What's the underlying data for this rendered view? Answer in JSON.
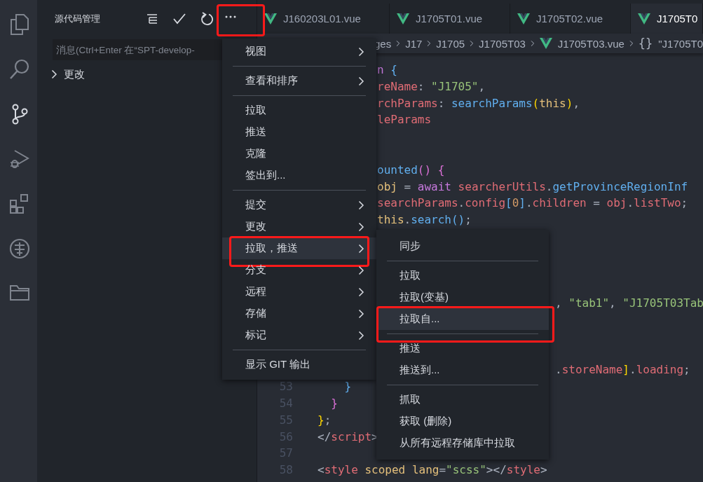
{
  "activity_bar": {
    "items": [
      {
        "kind": "files",
        "selected": false
      },
      {
        "kind": "search",
        "selected": false
      },
      {
        "kind": "source-control",
        "selected": true
      },
      {
        "kind": "run",
        "selected": false
      },
      {
        "kind": "extensions",
        "selected": false
      },
      {
        "kind": "coin",
        "selected": false
      },
      {
        "kind": "folder",
        "selected": false
      }
    ]
  },
  "sidebar": {
    "title": "源代码管理",
    "actions": [
      {
        "kind": "tree",
        "annotated": false
      },
      {
        "kind": "check",
        "annotated": false
      },
      {
        "kind": "refresh",
        "annotated": false
      },
      {
        "kind": "more",
        "annotated": true
      }
    ],
    "message": {
      "placeholder": "消息(Ctrl+Enter 在“SPT-develop-"
    },
    "sections": [
      {
        "label": "更改",
        "expanded": false
      }
    ]
  },
  "tabs": [
    {
      "label": "J160203L01.vue",
      "selected": false
    },
    {
      "label": "J1705T01.vue",
      "selected": false
    },
    {
      "label": "J1705T02.vue",
      "selected": false
    },
    {
      "label": "J1705T0",
      "selected": true
    }
  ],
  "breadcrumb": [
    {
      "kind": "folder",
      "label": "ges"
    },
    {
      "kind": "folder",
      "label": "J17"
    },
    {
      "kind": "folder",
      "label": "J1705"
    },
    {
      "kind": "folder",
      "label": "J1705T03"
    },
    {
      "kind": "file",
      "label": "J1705T03.vue"
    },
    {
      "kind": "symbol",
      "icon": "{}",
      "label": "\"J1705T0"
    }
  ],
  "code": [
    {
      "kind": "code",
      "tokens": [
        {
          "kind": "keyword",
          "text": "n"
        },
        {
          "kind": "bracket-blue",
          "text": " {"
        }
      ]
    },
    {
      "kind": "code",
      "tokens": [
        {
          "kind": "property",
          "text": "reName"
        },
        {
          "kind": "punct",
          "text": ": "
        },
        {
          "kind": "string",
          "text": "\"J1705\""
        },
        {
          "kind": "punct",
          "text": ","
        }
      ]
    },
    {
      "kind": "code",
      "tokens": [
        {
          "kind": "property",
          "text": "rchParams"
        },
        {
          "kind": "punct",
          "text": ": "
        },
        {
          "kind": "function",
          "text": "searchParams"
        },
        {
          "kind": "bracket-gold",
          "text": "("
        },
        {
          "kind": "variable",
          "text": "this"
        },
        {
          "kind": "bracket-gold",
          "text": ")"
        },
        {
          "kind": "punct",
          "text": ","
        }
      ]
    },
    {
      "kind": "code",
      "tokens": [
        {
          "kind": "property",
          "text": "leParams"
        }
      ]
    },
    {
      "kind": "blank"
    },
    {
      "kind": "blank"
    },
    {
      "kind": "code",
      "tokens": [
        {
          "kind": "function",
          "text": "ounted"
        },
        {
          "kind": "bracket-pink",
          "text": "()"
        },
        {
          "kind": "bracket-pink",
          "text": " {"
        }
      ]
    },
    {
      "kind": "code",
      "tokens": [
        {
          "kind": "variable",
          "text": "obj"
        },
        {
          "kind": "punct",
          "text": " = "
        },
        {
          "kind": "keyword",
          "text": "await"
        },
        {
          "kind": "property",
          "text": " searcherUtils"
        },
        {
          "kind": "punct",
          "text": "."
        },
        {
          "kind": "function",
          "text": "getProvinceRegionInf"
        }
      ]
    },
    {
      "kind": "code",
      "tokens": [
        {
          "kind": "property",
          "text": "searchParams"
        },
        {
          "kind": "punct",
          "text": "."
        },
        {
          "kind": "property",
          "text": "config"
        },
        {
          "kind": "bracket-blue",
          "text": "["
        },
        {
          "kind": "number",
          "text": "0"
        },
        {
          "kind": "bracket-blue",
          "text": "]"
        },
        {
          "kind": "punct",
          "text": "."
        },
        {
          "kind": "property",
          "text": "children"
        },
        {
          "kind": "punct",
          "text": " = "
        },
        {
          "kind": "property",
          "text": "obj"
        },
        {
          "kind": "punct",
          "text": "."
        },
        {
          "kind": "property",
          "text": "listTwo"
        },
        {
          "kind": "punct",
          "text": ";"
        }
      ]
    },
    {
      "kind": "code",
      "tokens": [
        {
          "kind": "variable",
          "text": "this"
        },
        {
          "kind": "punct",
          "text": "."
        },
        {
          "kind": "function",
          "text": "search"
        },
        {
          "kind": "bracket-blue",
          "text": "()"
        },
        {
          "kind": "punct",
          "text": ";"
        }
      ]
    },
    {
      "kind": "blank"
    },
    {
      "kind": "blank"
    },
    {
      "kind": "blank"
    },
    {
      "kind": "blank"
    },
    {
      "kind": "code",
      "tokens": [
        {
          "kind": "punct",
          "text": ", "
        },
        {
          "kind": "string",
          "text": "\"tab1\""
        },
        {
          "kind": "punct",
          "text": ", "
        },
        {
          "kind": "string",
          "text": "\"J1705T03Tab"
        }
      ]
    },
    {
      "kind": "blank"
    },
    {
      "kind": "blank"
    },
    {
      "kind": "blank"
    },
    {
      "kind": "code",
      "tokens": [
        {
          "kind": "punct",
          "text": "."
        },
        {
          "kind": "property",
          "text": "storeName"
        },
        {
          "kind": "bracket-gold",
          "text": "]"
        },
        {
          "kind": "punct",
          "text": "."
        },
        {
          "kind": "property",
          "text": "loading"
        },
        {
          "kind": "punct",
          "text": ";"
        }
      ]
    },
    {
      "kind": "code",
      "number": "53",
      "tokens": [
        {
          "kind": "bracket-blue",
          "text": "    }"
        }
      ]
    },
    {
      "kind": "code",
      "number": "54",
      "tokens": [
        {
          "kind": "bracket-pink",
          "text": "  }"
        }
      ]
    },
    {
      "kind": "code",
      "number": "55",
      "tokens": [
        {
          "kind": "bracket-gold",
          "text": "}"
        },
        {
          "kind": "punct",
          "text": ";"
        }
      ]
    },
    {
      "kind": "code",
      "number": "56",
      "tokens": [
        {
          "kind": "punct",
          "text": "</"
        },
        {
          "kind": "property",
          "text": "script"
        },
        {
          "kind": "punct",
          "text": ">"
        }
      ]
    },
    {
      "kind": "blank",
      "number": "57"
    },
    {
      "kind": "code",
      "number": "58",
      "tokens": [
        {
          "kind": "punct",
          "text": "<"
        },
        {
          "kind": "property",
          "text": "style"
        },
        {
          "kind": "variable",
          "text": " scoped"
        },
        {
          "kind": "variable",
          "text": " lang"
        },
        {
          "kind": "punct",
          "text": "="
        },
        {
          "kind": "string",
          "text": "\"scss\""
        },
        {
          "kind": "punct",
          "text": "></"
        },
        {
          "kind": "property",
          "text": "style"
        },
        {
          "kind": "punct",
          "text": ">"
        }
      ]
    }
  ],
  "menu": {
    "items": [
      {
        "kind": "item",
        "label": "视图",
        "submenu": true,
        "selected": false,
        "annotated": false
      },
      {
        "kind": "separator"
      },
      {
        "kind": "item",
        "label": "查看和排序",
        "submenu": true,
        "selected": false,
        "annotated": false
      },
      {
        "kind": "separator"
      },
      {
        "kind": "item",
        "label": "拉取",
        "submenu": false,
        "selected": false,
        "annotated": false
      },
      {
        "kind": "item",
        "label": "推送",
        "submenu": false,
        "selected": false,
        "annotated": false
      },
      {
        "kind": "item",
        "label": "克隆",
        "submenu": false,
        "selected": false,
        "annotated": false
      },
      {
        "kind": "item",
        "label": "签出到...",
        "submenu": false,
        "selected": false,
        "annotated": false
      },
      {
        "kind": "separator"
      },
      {
        "kind": "item",
        "label": "提交",
        "submenu": true,
        "selected": false,
        "annotated": false
      },
      {
        "kind": "item",
        "label": "更改",
        "submenu": true,
        "selected": false,
        "annotated": false
      },
      {
        "kind": "item",
        "label": "拉取，推送",
        "submenu": true,
        "selected": true,
        "annotated": true
      },
      {
        "kind": "item",
        "label": "分支",
        "submenu": true,
        "selected": false,
        "annotated": false
      },
      {
        "kind": "item",
        "label": "远程",
        "submenu": true,
        "selected": false,
        "annotated": false
      },
      {
        "kind": "item",
        "label": "存储",
        "submenu": true,
        "selected": false,
        "annotated": false
      },
      {
        "kind": "item",
        "label": "标记",
        "submenu": true,
        "selected": false,
        "annotated": false
      },
      {
        "kind": "separator"
      },
      {
        "kind": "item",
        "label": "显示 GIT 输出",
        "submenu": false,
        "selected": false,
        "annotated": false
      }
    ]
  },
  "submenu": {
    "items": [
      {
        "kind": "item",
        "label": "同步",
        "selected": false,
        "annotated": false
      },
      {
        "kind": "separator"
      },
      {
        "kind": "item",
        "label": "拉取",
        "selected": false,
        "annotated": false
      },
      {
        "kind": "item",
        "label": "拉取(变基)",
        "selected": false,
        "annotated": false
      },
      {
        "kind": "item",
        "label": "拉取自...",
        "selected": true,
        "annotated": true
      },
      {
        "kind": "separator"
      },
      {
        "kind": "item",
        "label": "推送",
        "selected": false,
        "annotated": false
      },
      {
        "kind": "item",
        "label": "推送到...",
        "selected": false,
        "annotated": false
      },
      {
        "kind": "separator"
      },
      {
        "kind": "item",
        "label": "抓取",
        "selected": false,
        "annotated": false
      },
      {
        "kind": "item",
        "label": "获取 (删除)",
        "selected": false,
        "annotated": false
      },
      {
        "kind": "item",
        "label": "从所有远程存储库中拉取",
        "selected": false,
        "annotated": false
      }
    ]
  }
}
